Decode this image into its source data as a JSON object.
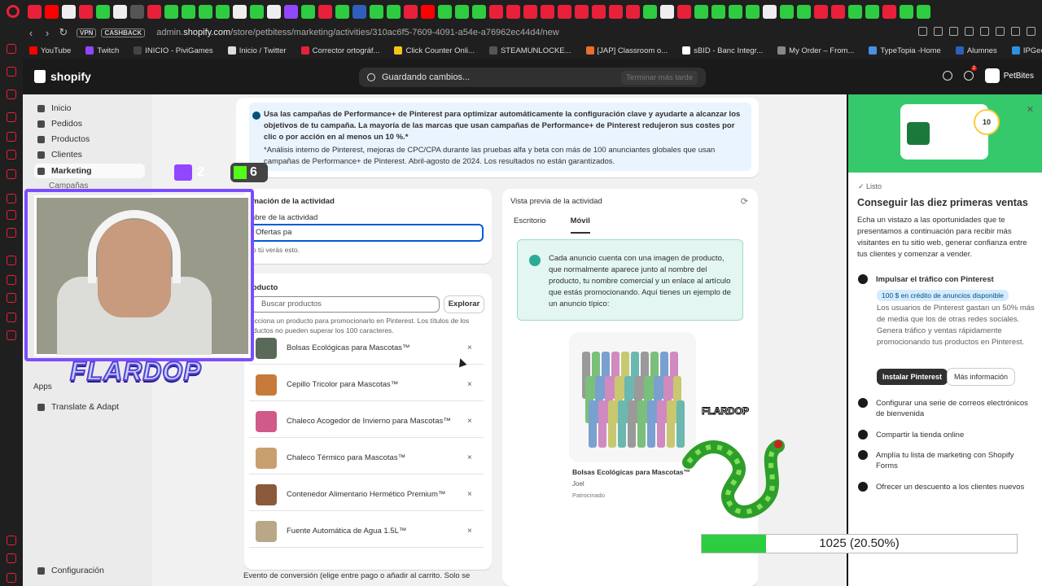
{
  "browser": {
    "url_prefix": "admin.",
    "url_host": "shopify.com",
    "url_path": "/store/petbitess/marketing/activities/310ac6f5-7609-4091-a54e-a76962ec44d4/new",
    "vpn_label": "VPN",
    "cashback_label": "CASHBACK",
    "bookmarks": [
      {
        "label": "YouTube",
        "color": "#ff0000"
      },
      {
        "label": "Twitch",
        "color": "#9146ff"
      },
      {
        "label": "INICIO - PiviGames",
        "color": "#444444"
      },
      {
        "label": "Inicio / Twitter",
        "color": "#dddddd"
      },
      {
        "label": "Corrector ortográf...",
        "color": "#e8203a"
      },
      {
        "label": "Click Counter Onli...",
        "color": "#f5c518"
      },
      {
        "label": "STEAMUNLOCKE...",
        "color": "#555555"
      },
      {
        "label": "[JAP] Classroom o...",
        "color": "#e8702a"
      },
      {
        "label": "sBID - Banc Integr...",
        "color": "#ffffff"
      },
      {
        "label": "My Order – From...",
        "color": "#888888"
      },
      {
        "label": "TypeTopia -Home",
        "color": "#4a90e2"
      },
      {
        "label": "Alumnes",
        "color": "#2f5fbb"
      },
      {
        "label": "IPGeolocation API...",
        "color": "#2f8fe2"
      }
    ]
  },
  "shopify": {
    "logo_text": "shopify",
    "saving_text": "Guardando cambios...",
    "finish_later": "Terminar más tarde",
    "store_name": "PetBites",
    "notifications_count": "2"
  },
  "nav": {
    "items": [
      "Inicio",
      "Pedidos",
      "Productos",
      "Clientes",
      "Marketing"
    ],
    "sub_items": [
      "Campañas"
    ],
    "apps_label": "Apps",
    "translate_label": "Translate & Adapt",
    "settings_label": "Configuración"
  },
  "banner": {
    "text": "Usa las campañas de Performance+ de Pinterest para optimizar automáticamente la configuración clave y ayudarte a alcanzar los objetivos de tu campaña. La mayoría de las marcas que usan campañas de Performance+ de Pinterest redujeron sus costes por clic o por acción en al menos un 10 %.*",
    "footnote": "*Análisis interno de Pinterest, mejoras de CPC/CPA durante las pruebas alfa y beta con más de 100 anunciantes globales que usan campañas de Performance+ de Pinterest. Abril-agosto de 2024. Los resultados no están garantizados."
  },
  "activity": {
    "heading": "ormación de la actividad",
    "name_label": "ombre de la actividad",
    "name_value": "Ofertas pa",
    "hint": "lo tú verás esto."
  },
  "product": {
    "heading": "roducto",
    "search_placeholder": "Buscar productos",
    "explore_label": "Explorar",
    "help": "lecciona un producto para promocionarlo en Pinterest. Los títulos de los oductos no pueden superar los 100 caracteres.",
    "items": [
      {
        "name": "Bolsas Ecológicas para Mascotas™",
        "thumb": "#5a6a5a"
      },
      {
        "name": "Cepillo Tricolor para Mascotas™",
        "thumb": "#c87a3a"
      },
      {
        "name": "Chaleco Acogedor de Invierno para Mascotas™",
        "thumb": "#d05a8a"
      },
      {
        "name": "Chaleco Térmico para Mascotas™",
        "thumb": "#c8a070"
      },
      {
        "name": "Contenedor Alimentario Hermético Premium™",
        "thumb": "#8a5a3a"
      },
      {
        "name": "Fuente Automática de Agua 1.5L™",
        "thumb": "#b8a888"
      }
    ],
    "remove_symbol": "×",
    "conversion_text": "Evento de conversión (elige entre pago o añadir al carrito. Solo se"
  },
  "preview": {
    "heading": "Vista previa de la actividad",
    "tab_desktop": "Escritorio",
    "tab_mobile": "Móvil",
    "info": "Cada anuncio cuenta con una imagen de producto, que normalmente aparece junto al nombre del producto, tu nombre comercial y un enlace al artículo que estás promocionando. Aquí tienes un ejemplo de un anuncio típico:",
    "product_name": "Bolsas Ecológicas para Mascotas™",
    "author": "Joel",
    "sponsored": "Patrocinado",
    "roll_colors": [
      "#9a9a9a",
      "#7ac07a",
      "#7aa0d0",
      "#d08ac0",
      "#c8c870",
      "#6ab8b0"
    ]
  },
  "setup": {
    "badge": "10",
    "done_label": "Listo",
    "title": "Conseguir las diez primeras ventas",
    "intro": "Echa un vistazo a las oportunidades que te presentamos a continuación para recibir más visitantes en tu sitio web, generar confianza entre tus clientes y comenzar a vender.",
    "pinterest_item": "Impulsar el tráfico con Pinterest",
    "credit": "100 $ en crédito de anuncios disponible",
    "pinterest_desc": "Los usuarios de Pinterest gastan un 50% más de media que los de otras redes sociales. Genera tráfico y ventas rápidamente promocionando tus productos en Pinterest.",
    "install_button": "Instalar Pinterest",
    "more_button": "Más información",
    "items": [
      "Configurar una serie de correos electrónicos de bienvenida",
      "Compartir la tienda online",
      "Amplía tu lista de marketing con Shopify Forms",
      "Ofrecer un descuento a los clientes nuevos"
    ]
  },
  "overlay": {
    "twitch_count": "2",
    "kick_count": "6",
    "streamer_name": "FLARDOP",
    "progress_text": "1025 (20.50%)",
    "progress_fraction": 0.205
  }
}
